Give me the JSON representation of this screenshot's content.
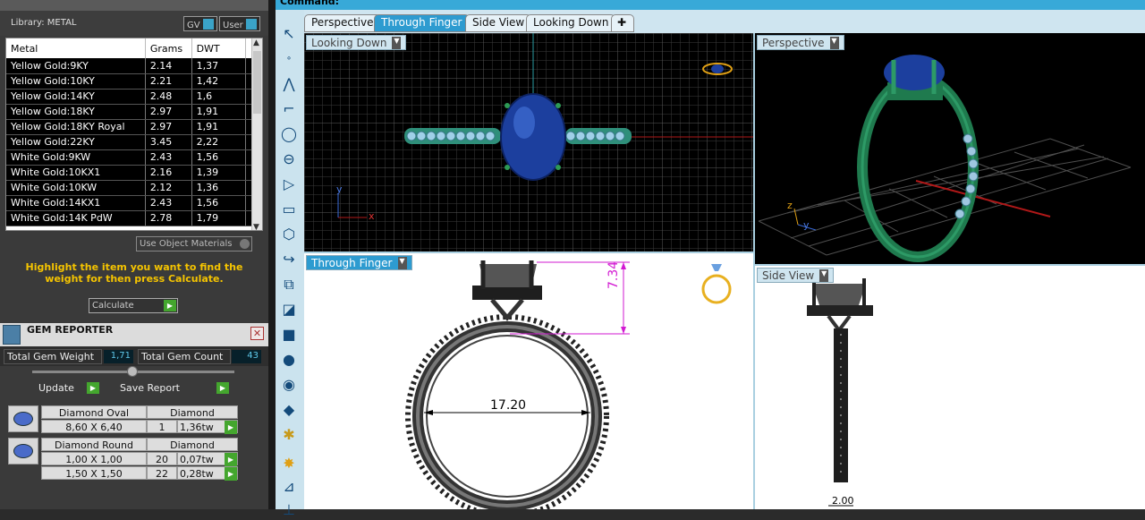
{
  "library": {
    "label": "Library: METAL",
    "gv_toggle": "GV",
    "user_toggle": "User"
  },
  "metal_table": {
    "headers": [
      "Metal",
      "Grams",
      "DWT"
    ],
    "rows": [
      [
        "Yellow Gold:9KY",
        "2.14",
        "1,37"
      ],
      [
        "Yellow Gold:10KY",
        "2.21",
        "1,42"
      ],
      [
        "Yellow Gold:14KY",
        "2.48",
        "1,6"
      ],
      [
        "Yellow Gold:18KY",
        "2.97",
        "1,91"
      ],
      [
        "Yellow Gold:18KY Royal",
        "2.97",
        "1,91"
      ],
      [
        "Yellow Gold:22KY",
        "3.45",
        "2,22"
      ],
      [
        "White Gold:9KW",
        "2.43",
        "1,56"
      ],
      [
        "White Gold:10KX1",
        "2.16",
        "1,39"
      ],
      [
        "White Gold:10KW",
        "2.12",
        "1,36"
      ],
      [
        "White Gold:14KX1",
        "2.43",
        "1,56"
      ],
      [
        "White Gold:14K PdW",
        "2.78",
        "1,79"
      ]
    ]
  },
  "use_object_materials": "Use Object Materials",
  "hint": "Highlight the item you want to find the weight for then press Calculate.",
  "calculate_label": "Calculate",
  "gem_reporter": {
    "title": "GEM REPORTER",
    "total_weight_label": "Total Gem Weight",
    "total_weight_value": "1,71",
    "total_count_label": "Total Gem Count",
    "total_count_value": "43",
    "update_label": "Update",
    "save_report_label": "Save Report",
    "groups": [
      {
        "shape": "Diamond Oval",
        "material": "Diamond",
        "rows": [
          [
            "8,60 X 6,40",
            "1",
            "1,36tw"
          ]
        ]
      },
      {
        "shape": "Diamond Round",
        "material": "Diamond",
        "rows": [
          [
            "1,00 X 1,00",
            "20",
            "0,07tw"
          ],
          [
            "1,50 X 1,50",
            "22",
            "0,28tw"
          ]
        ]
      }
    ]
  },
  "command_label": "Command:",
  "tabs": [
    "Perspective",
    "Through Finger",
    "Side View",
    "Looking Down"
  ],
  "active_tab": 1,
  "viewports": {
    "looking_down": {
      "label": "Looking Down",
      "axis_x": "x",
      "axis_y": "y"
    },
    "perspective": {
      "label": "Perspective",
      "axis_x": "x",
      "axis_y": "y",
      "axis_z": "z"
    },
    "through_finger": {
      "label": "Through Finger",
      "dim_height": "7.34",
      "dim_width": "17.20"
    },
    "side_view": {
      "label": "Side View",
      "dim_width": "2.00"
    }
  },
  "colors": {
    "accent": "#2d9bd0",
    "command_bar": "#38a9d8",
    "ring_green": "#1f7a4e",
    "gem_blue": "#1c3f9e",
    "dimension_magenta": "#d21ad2",
    "hint_yellow": "#f5c400"
  }
}
